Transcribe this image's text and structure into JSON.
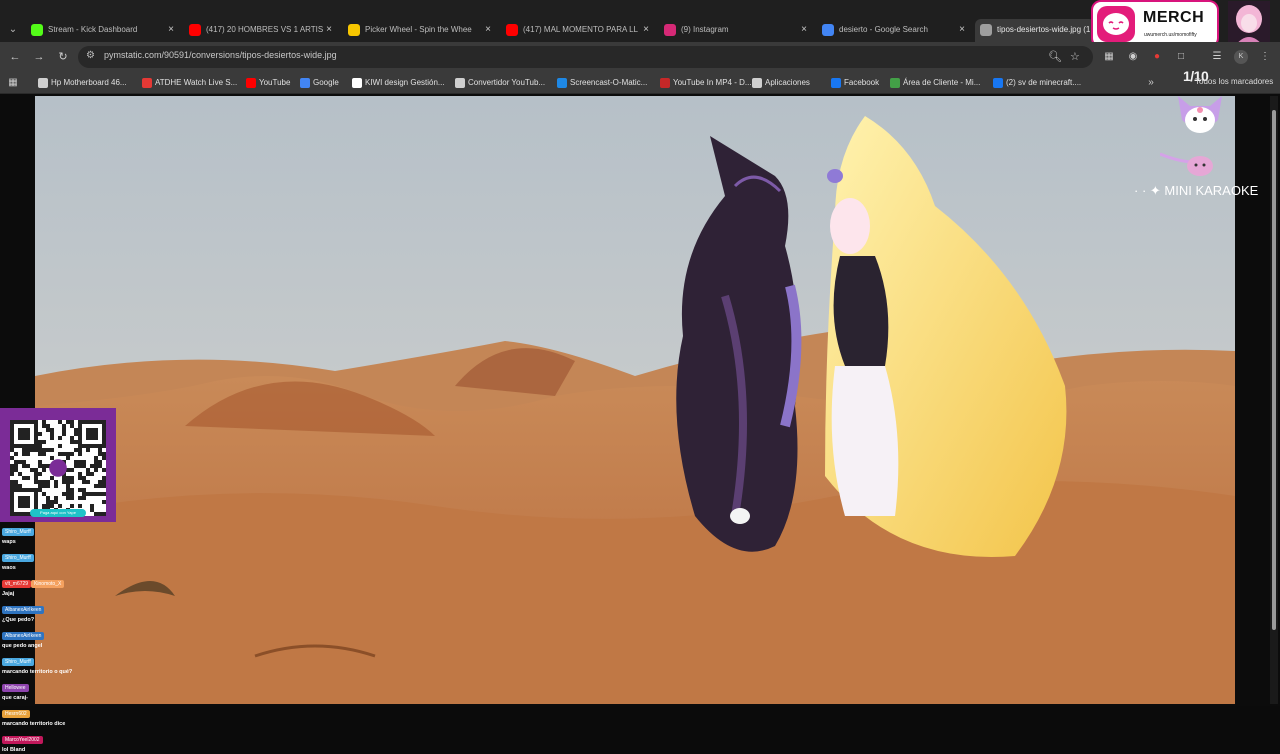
{
  "browser": {
    "tabs": [
      {
        "label": "Stream - Kick Dashboard",
        "favicon": "kick-icon",
        "color": "#53fc18"
      },
      {
        "label": "(417) 20 HOMBRES VS 1 ARTIS",
        "favicon": "youtube-icon",
        "color": "#ff0000"
      },
      {
        "label": "Picker Wheel - Spin the Whee",
        "favicon": "wheel-icon",
        "color": "#f7c600"
      },
      {
        "label": "(417) MAL MOMENTO PARA LL",
        "favicon": "youtube-icon",
        "color": "#ff0000"
      },
      {
        "label": "(9) Instagram",
        "favicon": "instagram-icon",
        "color": "#d62976"
      },
      {
        "label": "desierto - Google Search",
        "favicon": "google-icon",
        "color": "#4285f4"
      },
      {
        "label": "tipos-desiertos-wide.jpg (1",
        "favicon": "image-icon",
        "color": "#9e9e9e"
      }
    ],
    "url": "pymstatic.com/90591/conversions/tipos-desiertos-wide.jpg",
    "bookmarks": [
      {
        "label": "Hp Motherboard 46...",
        "icon": "page-icon",
        "color": "#cfcfcf"
      },
      {
        "label": "ATDHE Watch Live S...",
        "icon": "atdhe-icon",
        "color": "#e53935"
      },
      {
        "label": "YouTube",
        "icon": "youtube-icon",
        "color": "#ff0000"
      },
      {
        "label": "Google",
        "icon": "google-icon",
        "color": "#4285f4"
      },
      {
        "label": "KIWI design Gestión...",
        "icon": "kiwi-icon",
        "color": "#ffffff"
      },
      {
        "label": "Convertidor YouTub...",
        "icon": "page-icon",
        "color": "#cfcfcf"
      },
      {
        "label": "Screencast-O-Matic...",
        "icon": "screencast-icon",
        "color": "#1e88e5"
      },
      {
        "label": "YouTube In MP4 - D...",
        "icon": "mp4-icon",
        "color": "#c62828"
      },
      {
        "label": "Aplicaciones",
        "icon": "apps-icon",
        "color": "#cfcfcf"
      },
      {
        "label": "Facebook",
        "icon": "facebook-icon",
        "color": "#1877f2"
      },
      {
        "label": "Área de Cliente - Mi...",
        "icon": "client-area-icon",
        "color": "#43a047"
      },
      {
        "label": "(2) sv de minecraft....",
        "icon": "facebook-icon",
        "color": "#1877f2"
      }
    ],
    "bookmarks_overflow": "Todos los marcadores"
  },
  "overlay": {
    "merch_title": "MERCH",
    "merch_url": "uwumerch.us/momofifty",
    "counter": "1/10",
    "karaoke": "MINI KARAOKE",
    "qr_caption": "Paga aquí con Yape",
    "chat": [
      {
        "user": "Shiro_Murff",
        "user_color": "#4aa8e0",
        "message": "waps"
      },
      {
        "user": "Shiro_Murff",
        "user_color": "#4aa8e0",
        "message": "waos"
      },
      {
        "user": "vlt_m6729",
        "user_color": "#e53935",
        "message": ""
      },
      {
        "user": "Kinomoto_X",
        "user_color": "#f4a15f",
        "message": "Jajaj"
      },
      {
        "user": "AlbanexAirIkeen",
        "user_color": "#2f74c0",
        "message": "¿Que pedo?"
      },
      {
        "user": "AlbanexAirIkeen",
        "user_color": "#2f74c0",
        "message": "que pedo angel"
      },
      {
        "user": "Shiro_Murff",
        "user_color": "#4aa8e0",
        "message": "marcando territorio o qué?"
      },
      {
        "user": "Hellowee",
        "user_color": "#8e44ad",
        "message": "que caraj-"
      },
      {
        "user": "Hesrn602",
        "user_color": "#e8a13a",
        "message": "marcando territorio dice"
      },
      {
        "user": "MarcoYeel2002",
        "user_color": "#c2185b",
        "message": "lol Bland"
      }
    ]
  }
}
